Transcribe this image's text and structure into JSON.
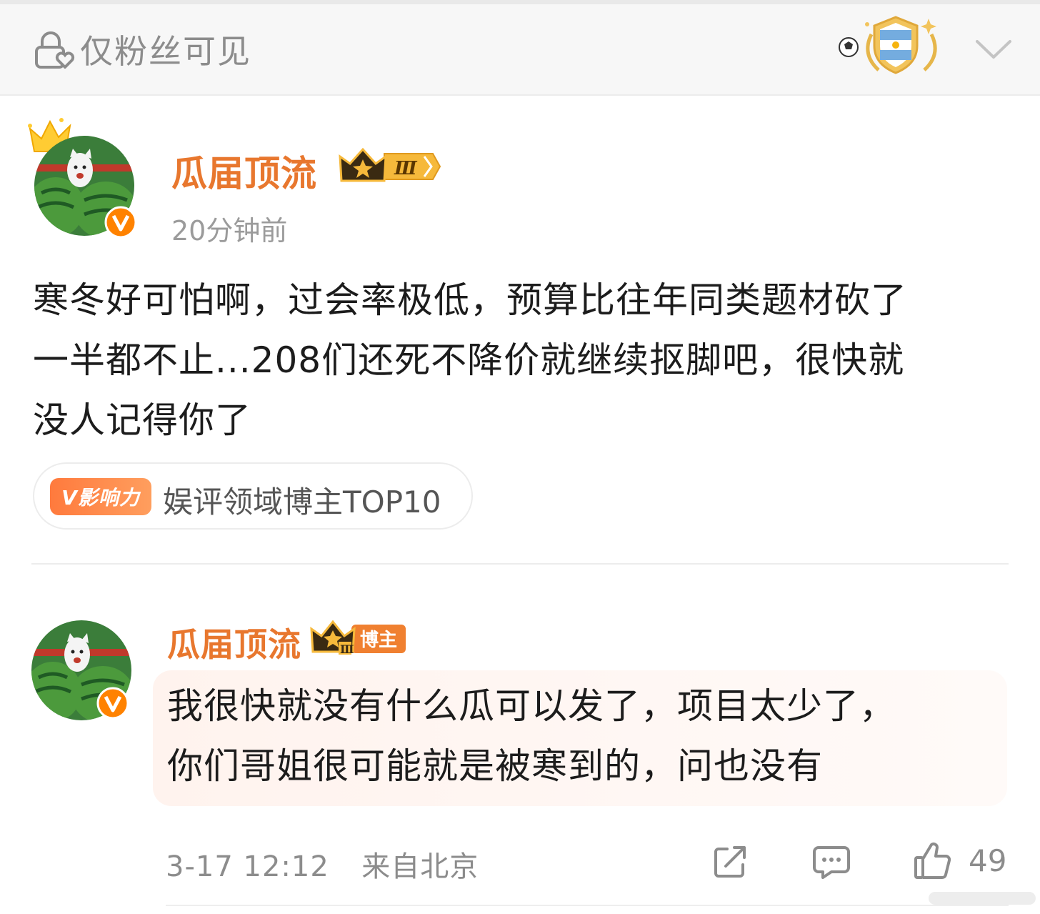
{
  "header": {
    "visibility_label": "仅粉丝可见",
    "visibility_icon": "lock-heart-icon",
    "badge_icon": "argentina-football-badge-icon",
    "expand_icon": "chevron-down-icon"
  },
  "post": {
    "author": "瓜届顶流",
    "level_badge": "Ⅲ",
    "time": "20分钟前",
    "text_lines": [
      "寒冬好可怕啊，过会率极低，预算比往年同类题材砍了",
      "一半都不止...208们还死不降价就继续抠脚吧，很快就",
      "没人记得你了"
    ],
    "influence": {
      "tag": "V影响力",
      "label": "娱评领域博主TOP10"
    }
  },
  "reply": {
    "author": "瓜届顶流",
    "badge_label": "博主",
    "level": "Ⅲ",
    "text_lines": [
      "我很快就没有什么瓜可以发了，项目太少了，",
      "你们哥姐很可能就是被寒到的，问也没有"
    ],
    "date": "3-17 12:12",
    "location": "来自北京",
    "likes": "49"
  },
  "colors": {
    "accent": "#e8772e",
    "verified": "#ff8200",
    "text": "#1c1c1c",
    "muted": "#8c8c8c"
  }
}
